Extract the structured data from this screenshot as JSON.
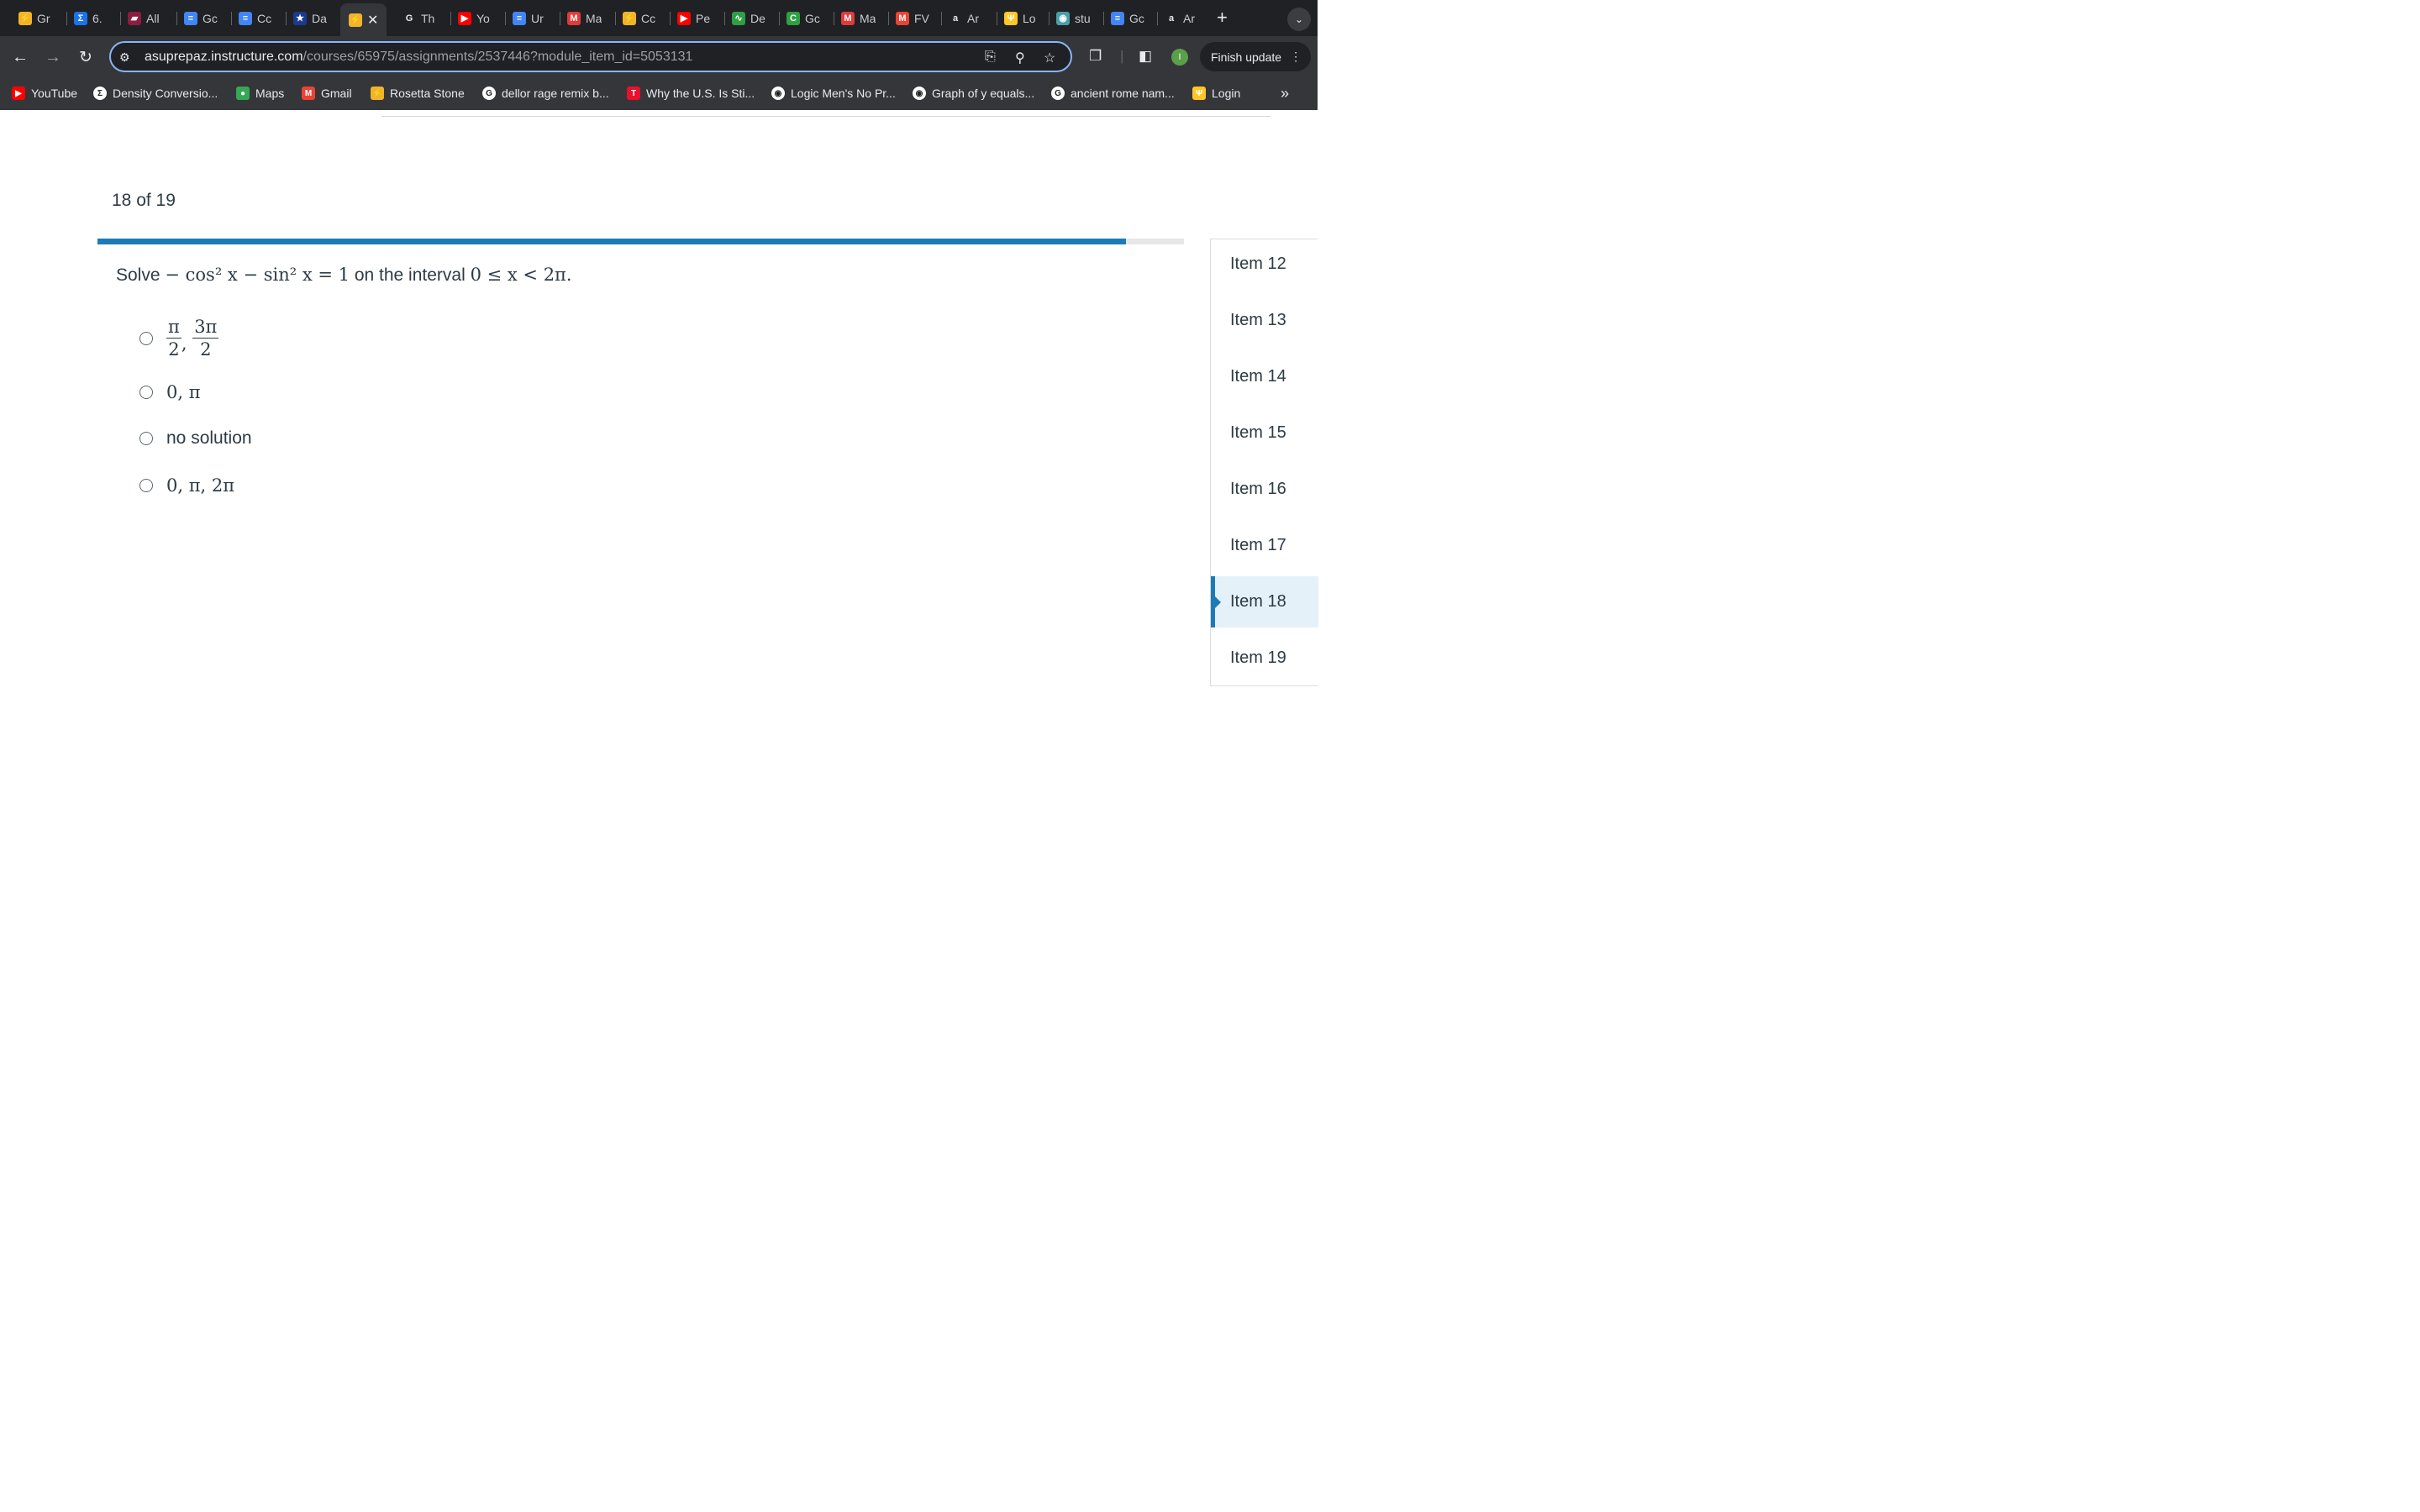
{
  "browser": {
    "tabs": [
      {
        "label": "Gr",
        "icon": "rosetta-icon",
        "color": "#f0b429"
      },
      {
        "label": "6.",
        "icon": "sigma-icon",
        "color": "#1a73e8"
      },
      {
        "label": "All",
        "icon": "asu-icon",
        "color": "#8c1d40"
      },
      {
        "label": "Gc",
        "icon": "docs-icon",
        "color": "#4285f4"
      },
      {
        "label": "Cc",
        "icon": "docs-icon",
        "color": "#4285f4"
      },
      {
        "label": "Da",
        "icon": "star-icon",
        "color": "#1a3a8f"
      },
      {
        "label": "",
        "icon": "rosetta-icon",
        "color": "#f0b429",
        "active": true,
        "close": "✕"
      },
      {
        "label": "Th",
        "icon": "google-icon",
        "color": "#ffffff"
      },
      {
        "label": "Yo",
        "icon": "youtube-icon",
        "color": "#ff0000"
      },
      {
        "label": "Ur",
        "icon": "docs-icon",
        "color": "#4285f4"
      },
      {
        "label": "Ma",
        "icon": "m-icon",
        "color": "#e23a3a"
      },
      {
        "label": "Cc",
        "icon": "rosetta-icon",
        "color": "#f0b429"
      },
      {
        "label": "Pe",
        "icon": "youtube-icon",
        "color": "#ff0000"
      },
      {
        "label": "De",
        "icon": "desmos-icon",
        "color": "#2f9e44"
      },
      {
        "label": "Gc",
        "icon": "c-icon",
        "color": "#2ea043"
      },
      {
        "label": "Ma",
        "icon": "m-icon",
        "color": "#e23a3a"
      },
      {
        "label": "FV",
        "icon": "gmail-icon",
        "color": "#ea4335"
      },
      {
        "label": "Ar",
        "icon": "amazon-icon",
        "color": "#ffffff"
      },
      {
        "label": "Lo",
        "icon": "asu-fork-icon",
        "color": "#ffc627"
      },
      {
        "label": "stu",
        "icon": "globe-icon",
        "color": "#4a9eaa"
      },
      {
        "label": "Gc",
        "icon": "docs-icon",
        "color": "#4285f4"
      },
      {
        "label": "Ar",
        "icon": "amazon-icon",
        "color": "#ffffff"
      }
    ],
    "new_tab": "+",
    "url_host": "asuprepaz.instructure.com",
    "url_path": "/courses/65975/assignments/2537446?module_item_id=5053131",
    "profile_initial": "I",
    "finish_update": "Finish update",
    "bookmarks": [
      {
        "label": "YouTube",
        "icon": "youtube-icon",
        "color": "#ff0000"
      },
      {
        "label": "Density Conversio...",
        "icon": "sigma-icon",
        "color": "#ffffff"
      },
      {
        "label": "Maps",
        "icon": "maps-icon",
        "color": "#34a853"
      },
      {
        "label": "Gmail",
        "icon": "gmail-icon",
        "color": "#ea4335"
      },
      {
        "label": "Rosetta Stone",
        "icon": "rosetta-icon",
        "color": "#f0b429"
      },
      {
        "label": "dellor rage remix b...",
        "icon": "google-icon",
        "color": "#ffffff"
      },
      {
        "label": "Why the U.S. Is Sti...",
        "icon": "t-icon",
        "color": "#e8112d"
      },
      {
        "label": "Logic Men's No Pr...",
        "icon": "globe-icon",
        "color": "#ffffff"
      },
      {
        "label": "Graph of y equals...",
        "icon": "globe-icon",
        "color": "#ffffff"
      },
      {
        "label": "ancient rome nam...",
        "icon": "google-icon",
        "color": "#ffffff"
      },
      {
        "label": "Login",
        "icon": "asu-fork-icon",
        "color": "#ffc627"
      }
    ]
  },
  "page": {
    "counter": "18 of 19",
    "progress": 0.947,
    "question": {
      "prefix": "Solve",
      "equation": "− cos² x − sin² x = 1",
      "middle": "on the interval",
      "interval": "0 ≤ x < 2π."
    },
    "options": [
      {
        "type": "fraction",
        "parts": [
          {
            "num": "π",
            "den": "2"
          },
          {
            "num": "3π",
            "den": "2"
          }
        ],
        "sep": ","
      },
      {
        "type": "math",
        "text": "0, π"
      },
      {
        "type": "text",
        "text": "no solution"
      },
      {
        "type": "math",
        "text": "0, π, 2π"
      }
    ],
    "sidebar": [
      {
        "label": "Item 12"
      },
      {
        "label": "Item 13"
      },
      {
        "label": "Item 14"
      },
      {
        "label": "Item 15"
      },
      {
        "label": "Item 16"
      },
      {
        "label": "Item 17"
      },
      {
        "label": "Item 18",
        "active": true
      },
      {
        "label": "Item 19"
      }
    ]
  }
}
